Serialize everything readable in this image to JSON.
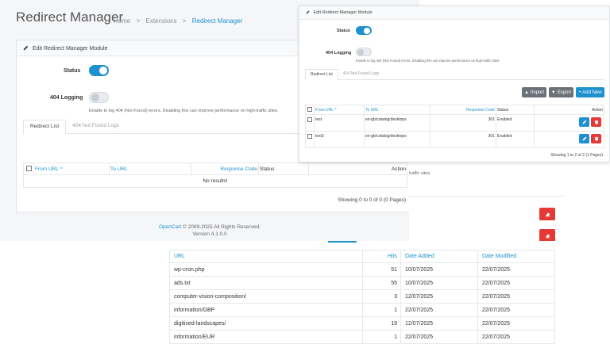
{
  "header": {
    "title": "Redirect Manager",
    "breadcrumb": [
      "Home",
      "Extensions",
      "Redirect Manager"
    ],
    "sep": ">"
  },
  "module": {
    "card_title": "Edit Redirect Manager Module",
    "status_label": "Status",
    "status_on": true,
    "logging_label": "404 Logging",
    "logging_on": false,
    "logging_help": "Enable to log 404 (Not Found) errors. Disabling this can improve performance on high-traffic sites.",
    "tabs": [
      "Redirect List",
      "404 Not Found Logs"
    ]
  },
  "redirect_table": {
    "columns": [
      "From URL ^",
      "To URL",
      "Response Code",
      "Status",
      "Action"
    ],
    "empty": "No results!",
    "pagination": "Showing 0 to 0 of 0 (0 Pages)"
  },
  "footer": {
    "brand": "OpenCart",
    "copyright": " © 2009-2025 All Rights Reserved.",
    "version": "Version 4.1.0.0"
  },
  "popup": {
    "buttons": {
      "import": "Import",
      "export": "Export",
      "add": "+ Add New"
    },
    "columns": [
      "From URL ^",
      "To URL",
      "Response Code",
      "Status",
      "Action"
    ],
    "rows": [
      {
        "from": "test",
        "to": "en-gb/catalog/desktops",
        "code": "301",
        "status": "Enabled"
      },
      {
        "from": "test2",
        "to": "en-gb/catalog/desktops",
        "code": "301",
        "status": "Enabled"
      }
    ],
    "pagination": "Showing 1 to 2 of 2 (1 Pages)"
  },
  "right_snip": {
    "text": "traffic sites."
  },
  "logs": {
    "columns": [
      "URL",
      "Hits",
      "Date Added",
      "Date Modified"
    ],
    "rows": [
      {
        "url": "wp-cron.php",
        "hits": "51",
        "added": "10/07/2025",
        "modified": "22/07/2025"
      },
      {
        "url": "ads.txt",
        "hits": "55",
        "added": "10/07/2025",
        "modified": "22/07/2025"
      },
      {
        "url": "computer-vision-composition/",
        "hits": "3",
        "added": "12/07/2025",
        "modified": "22/07/2025"
      },
      {
        "url": "information/GBP",
        "hits": "1",
        "added": "22/07/2025",
        "modified": "22/07/2025"
      },
      {
        "url": "digitised-landscapes/",
        "hits": "19",
        "added": "12/07/2025",
        "modified": "22/07/2025"
      },
      {
        "url": "information/EUR",
        "hits": "1",
        "added": "22/07/2025",
        "modified": "22/07/2025"
      }
    ]
  },
  "colors": {
    "accent": "#1e91cf",
    "danger": "#e53935",
    "grey_button": "#6b7178"
  }
}
